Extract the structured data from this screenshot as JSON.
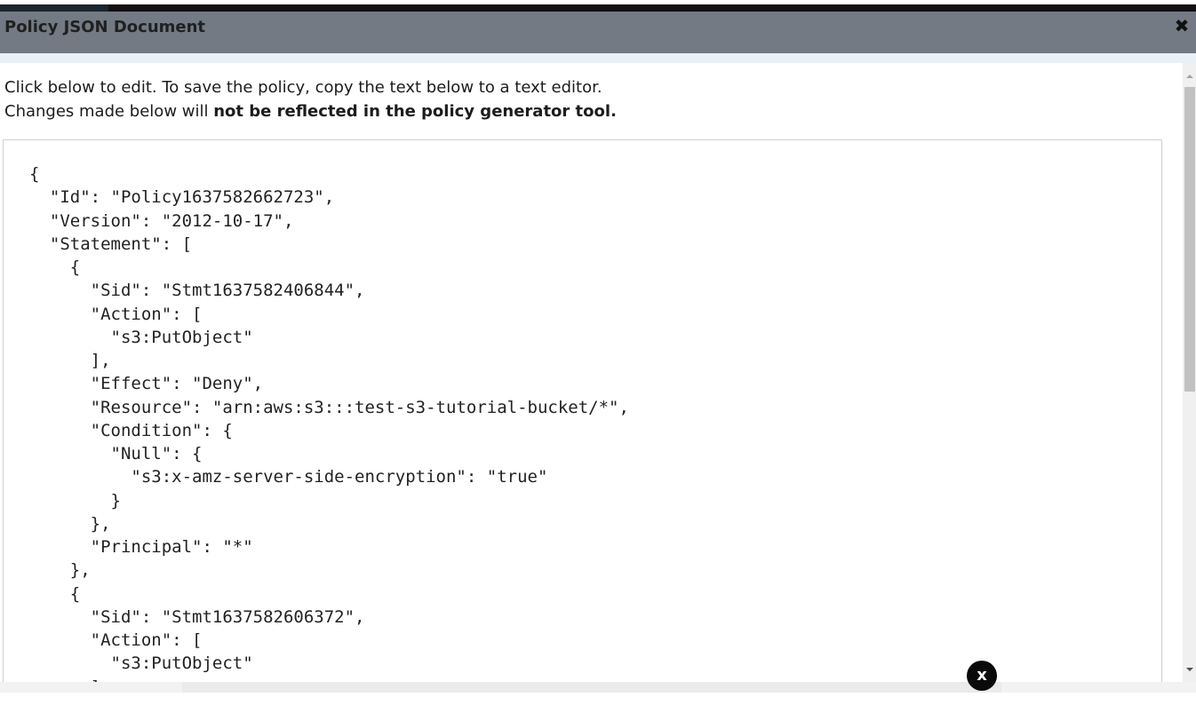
{
  "dialog": {
    "title": "Policy JSON Document",
    "close_icon": "close-icon",
    "close_glyph": "✖"
  },
  "instructions": {
    "line1": "Click below to edit. To save the policy, copy the text below to a text editor.",
    "line2_prefix": "Changes made below will ",
    "line2_bold": "not be reflected in the policy generator tool."
  },
  "editor": {
    "content": "{\n  \"Id\": \"Policy1637582662723\",\n  \"Version\": \"2012-10-17\",\n  \"Statement\": [\n    {\n      \"Sid\": \"Stmt1637582406844\",\n      \"Action\": [\n        \"s3:PutObject\"\n      ],\n      \"Effect\": \"Deny\",\n      \"Resource\": \"arn:aws:s3:::test-s3-tutorial-bucket/*\",\n      \"Condition\": {\n        \"Null\": {\n          \"s3:x-amz-server-side-encryption\": \"true\"\n        }\n      },\n      \"Principal\": \"*\"\n    },\n    {\n      \"Sid\": \"Stmt1637582606372\",\n      \"Action\": [\n        \"s3:PutObject\"\n      ],"
  },
  "overlay": {
    "close_label": "x"
  },
  "colors": {
    "header_bg": "#737a83",
    "header_rule": "#e9f1f7",
    "overlay_button": "#0a0a0a"
  }
}
